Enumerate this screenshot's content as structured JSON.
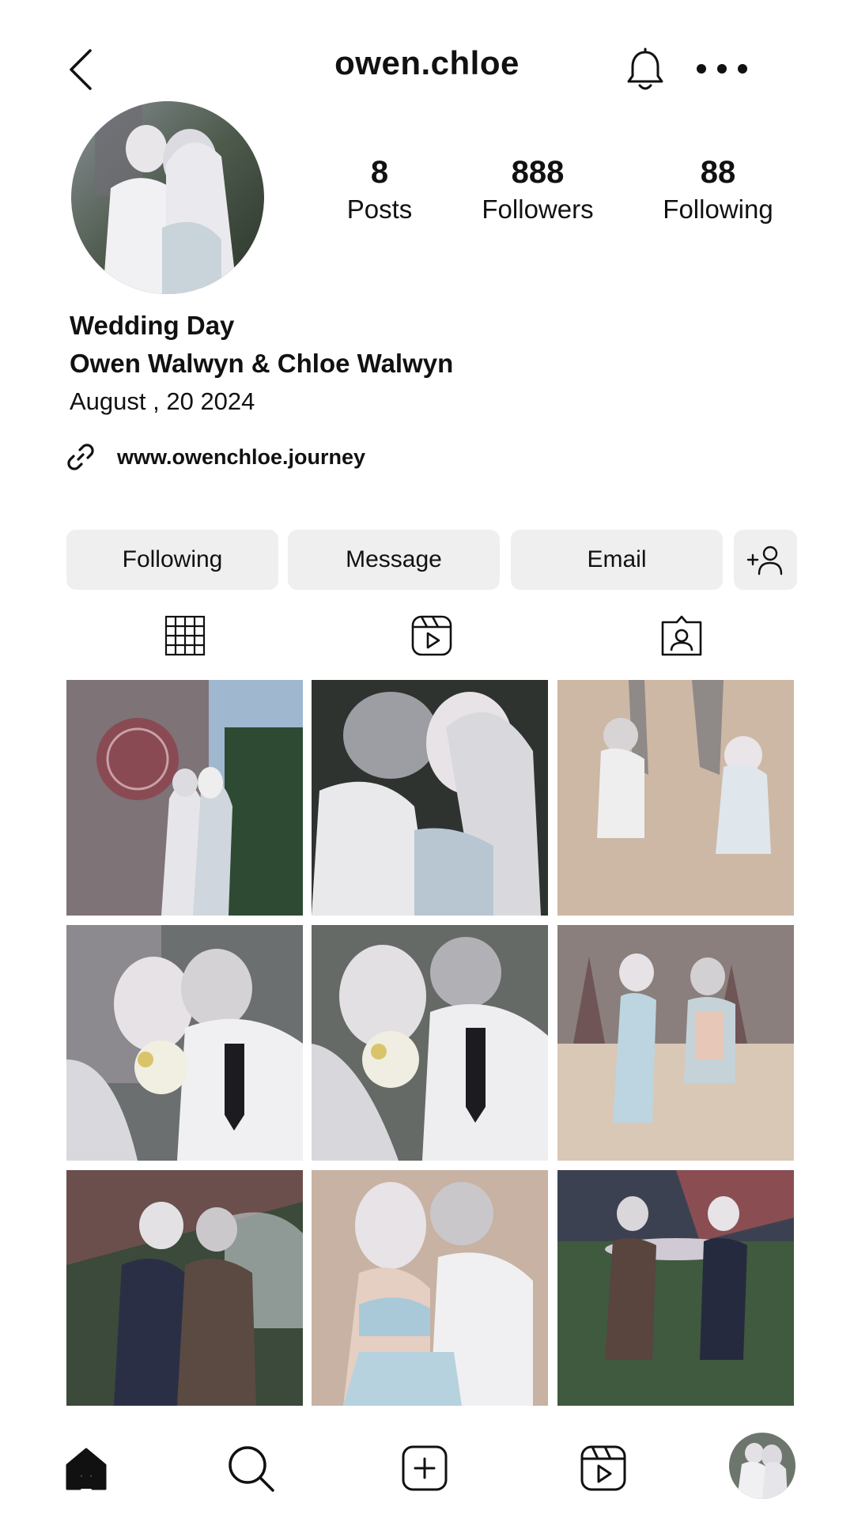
{
  "header": {
    "username": "owen.chloe",
    "back_icon": "chevron-left-icon",
    "bell_icon": "bell-icon",
    "more_icon": "more-horizontal-icon"
  },
  "profile": {
    "stats": [
      {
        "value": "8",
        "label": "Posts"
      },
      {
        "value": "888",
        "label": "Followers"
      },
      {
        "value": "88",
        "label": "Following"
      }
    ],
    "bio": {
      "line1": "Wedding Day",
      "line2": "Owen Walwyn & Chloe Walwyn",
      "line3": "August , 20 2024"
    },
    "link": {
      "text": "www.owenchloe.journey",
      "icon": "link-icon"
    }
  },
  "actions": {
    "following": "Following",
    "message": "Message",
    "email": "Email",
    "add_user_icon": "add-user-icon"
  },
  "tabs": [
    "grid-icon",
    "reels-icon",
    "tagged-icon"
  ],
  "posts": [
    "wedding-kiss-cathedral",
    "close-embrace",
    "beach-walk-holding-hands",
    "couple-with-bouquet",
    "couple-with-bouquet-2",
    "beach-dance",
    "coat-portrait-bridge",
    "hug-beach",
    "walk-park"
  ],
  "bottom_nav": [
    "home-icon",
    "search-icon",
    "create-icon",
    "reels-icon",
    "profile-avatar"
  ]
}
